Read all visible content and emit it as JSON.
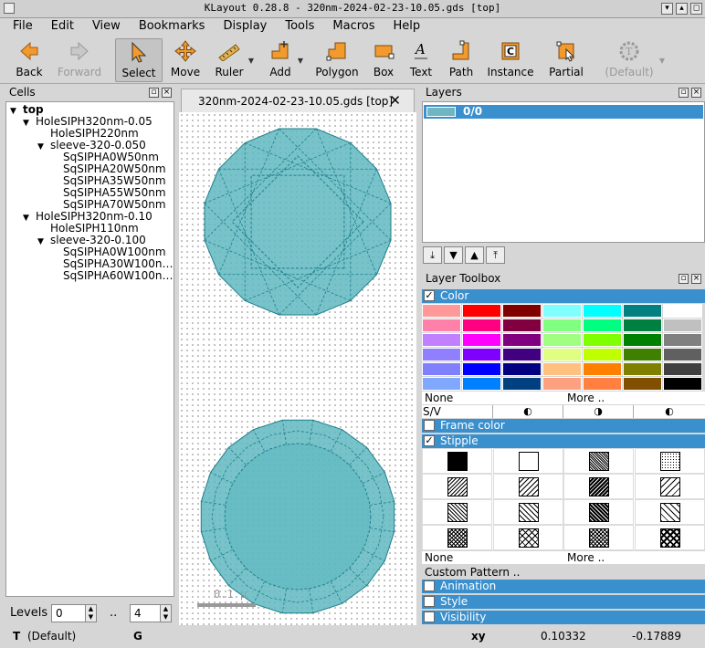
{
  "window": {
    "title": "KLayout 0.28.8 - 320nm-2024-02-23-10.05.gds [top]"
  },
  "menu": [
    "File",
    "Edit",
    "View",
    "Bookmarks",
    "Display",
    "Tools",
    "Macros",
    "Help"
  ],
  "toolbar": {
    "back": "Back",
    "forward": "Forward",
    "select": "Select",
    "move": "Move",
    "ruler": "Ruler",
    "add": "Add",
    "polygon": "Polygon",
    "box": "Box",
    "text": "Text",
    "path": "Path",
    "instance": "Instance",
    "partial": "Partial",
    "default": "(Default)"
  },
  "cells": {
    "title": "Cells",
    "tree": [
      {
        "label": "top",
        "depth": 0,
        "arrow": "▼",
        "bold": true
      },
      {
        "label": "HoleSIPH320nm-0.05",
        "depth": 1,
        "arrow": "▼"
      },
      {
        "label": "HoleSIPH220nm",
        "depth": 2,
        "arrow": ""
      },
      {
        "label": "sleeve-320-0.050",
        "depth": 2,
        "arrow": "▼"
      },
      {
        "label": "SqSIPHA0W50nm",
        "depth": 3,
        "arrow": ""
      },
      {
        "label": "SqSIPHA20W50nm",
        "depth": 3,
        "arrow": ""
      },
      {
        "label": "SqSIPHA35W50nm",
        "depth": 3,
        "arrow": ""
      },
      {
        "label": "SqSIPHA55W50nm",
        "depth": 3,
        "arrow": ""
      },
      {
        "label": "SqSIPHA70W50nm",
        "depth": 3,
        "arrow": ""
      },
      {
        "label": "HoleSIPH320nm-0.10",
        "depth": 1,
        "arrow": "▼"
      },
      {
        "label": "HoleSIPH110nm",
        "depth": 2,
        "arrow": ""
      },
      {
        "label": "sleeve-320-0.100",
        "depth": 2,
        "arrow": "▼"
      },
      {
        "label": "SqSIPHA0W100nm",
        "depth": 3,
        "arrow": ""
      },
      {
        "label": "SqSIPHA30W100n…",
        "depth": 3,
        "arrow": ""
      },
      {
        "label": "SqSIPHA60W100n…",
        "depth": 3,
        "arrow": ""
      }
    ],
    "levels_label": "Levels",
    "level_from": "0",
    "level_sep": "..",
    "level_to": "4"
  },
  "canvas": {
    "tab_title": "320nm-2024-02-23-10.05.gds [top]",
    "scale_text": "0.1 μ",
    "shape_color": "#5fb8c0",
    "shape_stroke": "#1e7f8e"
  },
  "layers": {
    "title": "Layers",
    "items": [
      {
        "name": "0/0",
        "color": "#6fb6c2"
      }
    ]
  },
  "toolbox": {
    "title": "Layer Toolbox",
    "color_label": "Color",
    "palette": [
      [
        "#ff9999",
        "#ff0000",
        "#800000",
        "#80ffff",
        "#00ffff",
        "#008080",
        "#ffffff"
      ],
      [
        "#ff80a8",
        "#ff0080",
        "#800040",
        "#80ff80",
        "#00ff80",
        "#008040",
        "#c0c0c0"
      ],
      [
        "#c080ff",
        "#ff00ff",
        "#800080",
        "#a0ff80",
        "#80ff00",
        "#008000",
        "#808080"
      ],
      [
        "#9080ff",
        "#8000ff",
        "#400080",
        "#e0ff80",
        "#c0ff00",
        "#408000",
        "#606060"
      ],
      [
        "#8080ff",
        "#0000ff",
        "#000080",
        "#ffc080",
        "#ff8000",
        "#808000",
        "#404040"
      ],
      [
        "#80a8ff",
        "#0080ff",
        "#004080",
        "#ffa080",
        "#ff8040",
        "#805000",
        "#000000"
      ]
    ],
    "none_label": "None",
    "more_label": "More ..",
    "sv_label": "S/V",
    "frame_color_label": "Frame color",
    "stipple_label": "Stipple",
    "stipple_none": "None",
    "stipple_more": "More ..",
    "custom_pattern": "Custom Pattern ..",
    "animation_label": "Animation",
    "style_label": "Style",
    "visibility_label": "Visibility"
  },
  "status": {
    "t_label": "T",
    "default_label": "(Default)",
    "g_label": "G",
    "xy_label": "xy",
    "x_value": "0.10332",
    "y_value": "-0.17889"
  }
}
